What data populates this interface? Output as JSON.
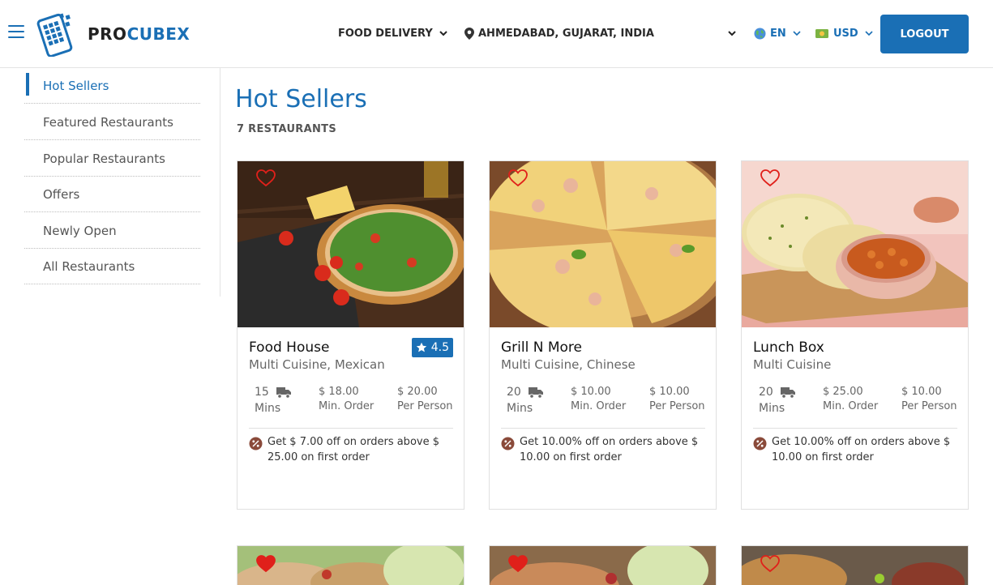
{
  "header": {
    "brand_part1": "PRO",
    "brand_part2": "CUBEX",
    "service": "FOOD DELIVERY",
    "location": "AHMEDABAD, GUJARAT, INDIA",
    "language": "EN",
    "currency": "USD",
    "logout_label": "LOGOUT"
  },
  "sidebar": {
    "items": [
      {
        "label": "Hot Sellers",
        "active": true
      },
      {
        "label": "Featured Restaurants"
      },
      {
        "label": "Popular Restaurants"
      },
      {
        "label": "Offers"
      },
      {
        "label": "Newly Open"
      },
      {
        "label": "All Restaurants"
      }
    ]
  },
  "main": {
    "title": "Hot Sellers",
    "count": "7 RESTAURANTS"
  },
  "restaurants": [
    {
      "name": "Food House",
      "cuisine": "Multi Cuisine, Mexican",
      "rating": "4.5",
      "time_value": "15",
      "time_unit": "Mins",
      "min_order": "$ 18.00",
      "min_order_label": "Min. Order",
      "per_person": "$ 20.00",
      "per_person_label": "Per Person",
      "offer": "Get $ 7.00 off on orders above $ 25.00 on first order",
      "favorite": false
    },
    {
      "name": "Grill N More",
      "cuisine": "Multi Cuisine, Chinese",
      "time_value": "20",
      "time_unit": "Mins",
      "min_order": "$ 10.00",
      "min_order_label": "Min. Order",
      "per_person": "$ 10.00",
      "per_person_label": "Per Person",
      "offer": "Get 10.00% off on orders above $ 10.00 on first order",
      "favorite": false
    },
    {
      "name": "Lunch Box",
      "cuisine": "Multi Cuisine",
      "time_value": "20",
      "time_unit": "Mins",
      "min_order": "$ 25.00",
      "min_order_label": "Min. Order",
      "per_person": "$ 10.00",
      "per_person_label": "Per Person",
      "offer": "Get 10.00% off on orders above $ 10.00 on first order",
      "favorite": false
    },
    {
      "favorite": true
    },
    {
      "favorite": true
    },
    {
      "favorite": false
    }
  ],
  "colors": {
    "accent": "#1a6fb5",
    "heart": "#e0201a",
    "offer_icon": "#8a4a3a"
  }
}
